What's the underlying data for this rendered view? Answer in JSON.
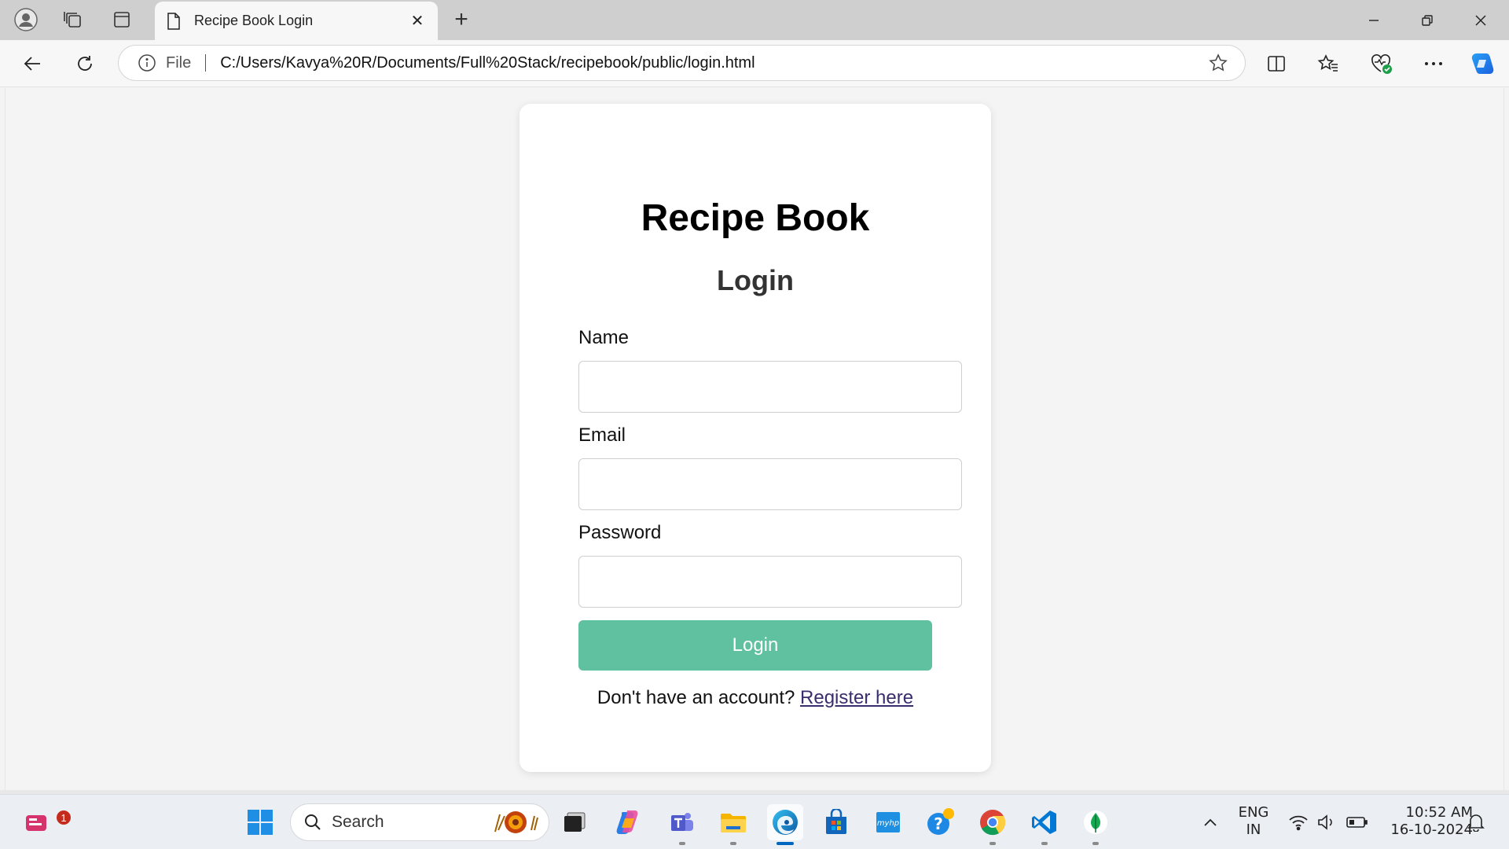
{
  "browser": {
    "tab_title": "Recipe Book Login",
    "address_scheme": "File",
    "address_url": "C:/Users/Kavya%20R/Documents/Full%20Stack/recipebook/public/login.html"
  },
  "page": {
    "title": "Recipe Book",
    "subtitle": "Login",
    "fields": [
      {
        "label": "Name",
        "value": "",
        "placeholder": ""
      },
      {
        "label": "Email",
        "value": "",
        "placeholder": ""
      },
      {
        "label": "Password",
        "value": "",
        "placeholder": ""
      }
    ],
    "login_button": "Login",
    "register_prompt": "Don't have an account?",
    "register_link": "Register here"
  },
  "colors": {
    "accent_button": "#60c1a0",
    "link": "#3a2d6e",
    "taskbar_active": "#0067c0"
  },
  "taskbar": {
    "search_label": "Search",
    "notification_count": "1",
    "language": "ENG",
    "region": "IN",
    "time": "10:52 AM",
    "date": "16-10-2024",
    "pinned_icons": [
      "windows-start",
      "task-view",
      "copilot",
      "teams",
      "file-explorer",
      "edge",
      "microsoft-store",
      "myhp",
      "get-help",
      "chrome",
      "vscode",
      "mongodb-compass"
    ]
  }
}
